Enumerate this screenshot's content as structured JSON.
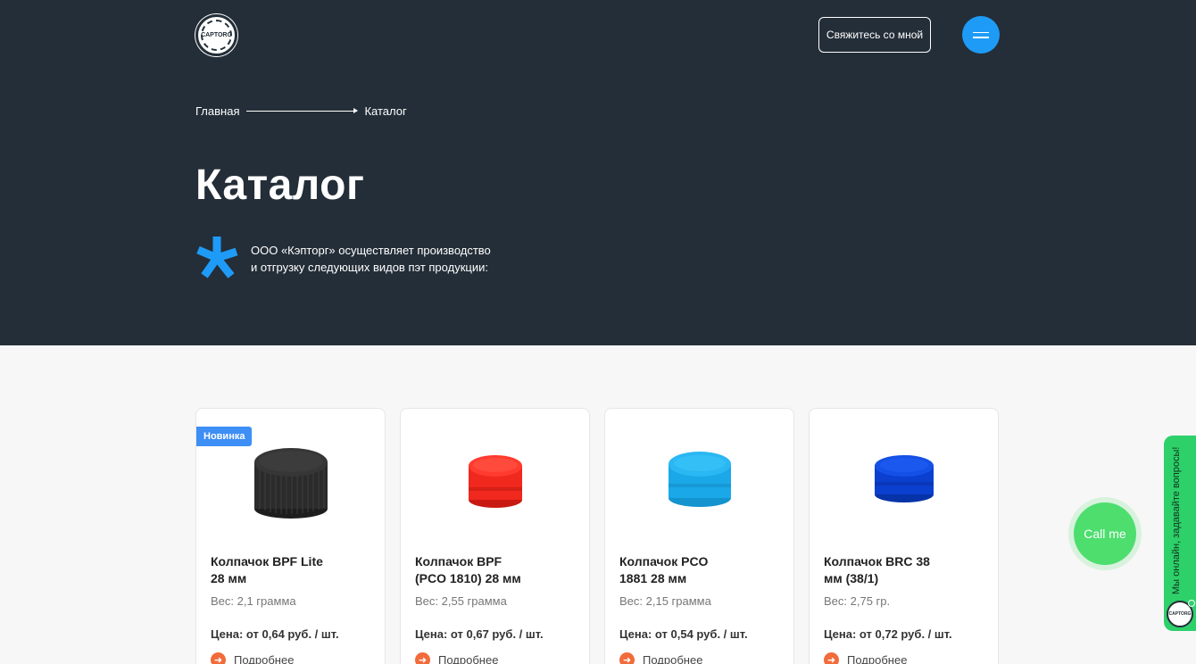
{
  "header": {
    "logo_text": "CAPTORG",
    "contact_label": "Свяжитесь со мной",
    "menu_icon": "hamburger-icon"
  },
  "breadcrumb": {
    "home": "Главная",
    "current": "Каталог"
  },
  "page": {
    "title": "Каталог",
    "intro_line1": "ООО «Кэпторг» осуществляет производство",
    "intro_line2": "и отгрузку следующих видов пэт продукции:",
    "accent_color": "#1e9bf7"
  },
  "products": [
    {
      "badge": "Новинка",
      "title_line1": "Колпачок BPF Lite",
      "title_line2": "28 мм",
      "weight": "Вес: 2,1 грамма",
      "price": "Цена: от 0,64 руб. / шт.",
      "more": "Подробнее",
      "cap_color": "#2b2b2b"
    },
    {
      "title_line1": "Колпачок BPF",
      "title_line2": "(PCO 1810) 28 мм",
      "weight": "Вес: 2,55 грамма",
      "price": "Цена: от 0,67 руб. / шт.",
      "more": "Подробнее",
      "cap_color": "#f0281e"
    },
    {
      "title_line1": "Колпачок PCO",
      "title_line2": "1881 28 мм",
      "weight": "Вес: 2,15 грамма",
      "price": "Цена: от 0,54 руб. / шт.",
      "more": "Подробнее",
      "cap_color": "#1ba8e8"
    },
    {
      "title_line1": "Колпачок BRC 38",
      "title_line2": "мм (38/1)",
      "weight": "Вес: 2,75 гр.",
      "price": "Цена: от 0,72 руб. / шт.",
      "more": "Подробнее",
      "cap_color": "#0a3fd0"
    }
  ],
  "widgets": {
    "call_label": "Call me",
    "chat_label": "Мы онлайн, задавайте вопросы!",
    "chat_logo": "CAPTORG"
  }
}
